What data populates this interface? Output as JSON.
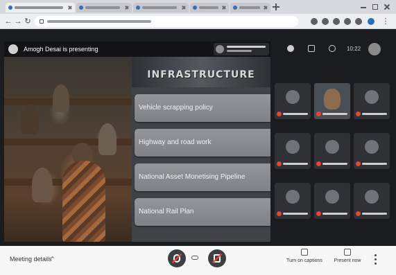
{
  "browser": {
    "tabs": [
      {
        "title": "",
        "active": true
      },
      {
        "title": "",
        "active": false
      },
      {
        "title": "",
        "active": false
      },
      {
        "title": "",
        "active": false
      },
      {
        "title": "",
        "active": false
      }
    ],
    "url": ""
  },
  "meet": {
    "presenting_label": "Amogh Desai is presenting",
    "slide": {
      "title": "INFRASTRUCTURE",
      "items": [
        "Vehicle scrapping policy",
        "Highway and road work",
        "National Asset Monetising Pipeline",
        "National Rail Plan"
      ]
    },
    "clock": "10:22",
    "participants": [
      {
        "name": "",
        "camera": false
      },
      {
        "name": "",
        "camera": true
      },
      {
        "name": "",
        "camera": false
      },
      {
        "name": "",
        "camera": false
      },
      {
        "name": "",
        "camera": false
      },
      {
        "name": "",
        "camera": false
      },
      {
        "name": "",
        "camera": false
      },
      {
        "name": "",
        "camera": false
      },
      {
        "name": "",
        "camera": false
      }
    ]
  },
  "controls": {
    "meeting_details": "Meeting details",
    "turn_on_captions": "Turn on captions",
    "present_now": "Present now"
  },
  "colors": {
    "meet_background": "#1b1c1f",
    "muted_red": "#ea4335",
    "self_avatar": "#2d6fb7"
  }
}
